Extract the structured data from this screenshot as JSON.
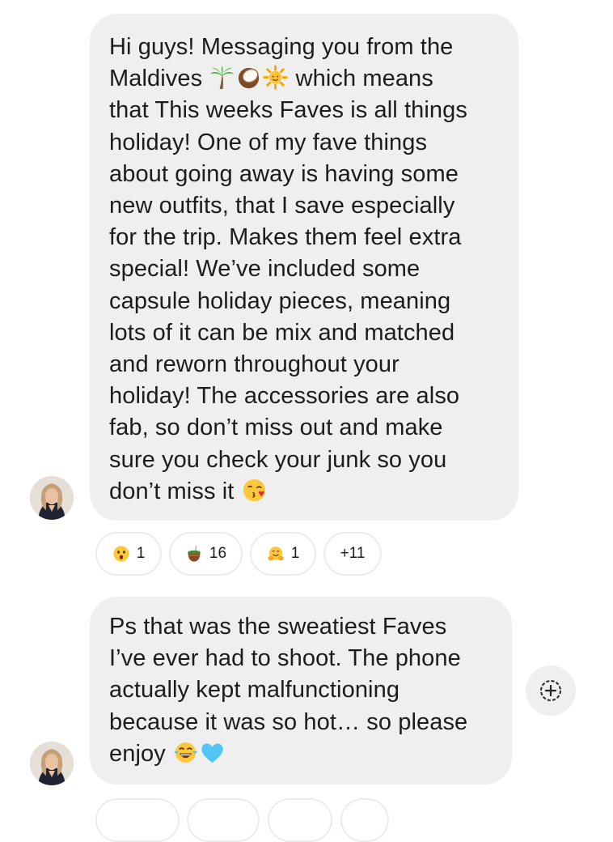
{
  "messages": [
    {
      "lines": [
        [
          "Hi guys! Messaging you from the"
        ],
        [
          "Maldives ",
          {
            "icon": "palm-tree-icon"
          },
          {
            "icon": "coconut-icon"
          },
          {
            "icon": "sun-icon"
          },
          " which means"
        ],
        [
          "that This weeks Faves is all things"
        ],
        [
          "holiday! One of my fave things"
        ],
        [
          "about going away is having some"
        ],
        [
          "new outfits, that I save especially"
        ],
        [
          "for the trip. Makes them feel extra"
        ],
        [
          "special! We’ve included some"
        ],
        [
          "capsule holiday pieces, meaning"
        ],
        [
          "lots of it can be mix and matched"
        ],
        [
          "and reworn throughout your"
        ],
        [
          "holiday! The accessories are also"
        ],
        [
          "fab, so don’t miss out and make"
        ],
        [
          "sure you check your junk so you"
        ],
        [
          "don’t miss it ",
          {
            "icon": "kissing-face-icon"
          }
        ]
      ],
      "reactions": [
        {
          "icon": "astonished-face-icon",
          "count": "1"
        },
        {
          "icon": "mate-drink-icon",
          "count": "16"
        },
        {
          "icon": "hugging-face-icon",
          "count": "1"
        },
        {
          "icon": "",
          "count": "+11"
        }
      ]
    },
    {
      "lines": [
        [
          "Ps that was the sweatiest Faves"
        ],
        [
          "I’ve ever had to shoot. The phone"
        ],
        [
          "actually kept malfunctioning"
        ],
        [
          "because it was so hot… so please"
        ],
        [
          "enjoy ",
          {
            "icon": "tears-of-joy-icon"
          },
          {
            "icon": "blue-heart-icon"
          }
        ]
      ]
    }
  ],
  "colors": {
    "bubble": "#efefef",
    "text": "#1c1c1c",
    "pill_border": "#ececec"
  }
}
